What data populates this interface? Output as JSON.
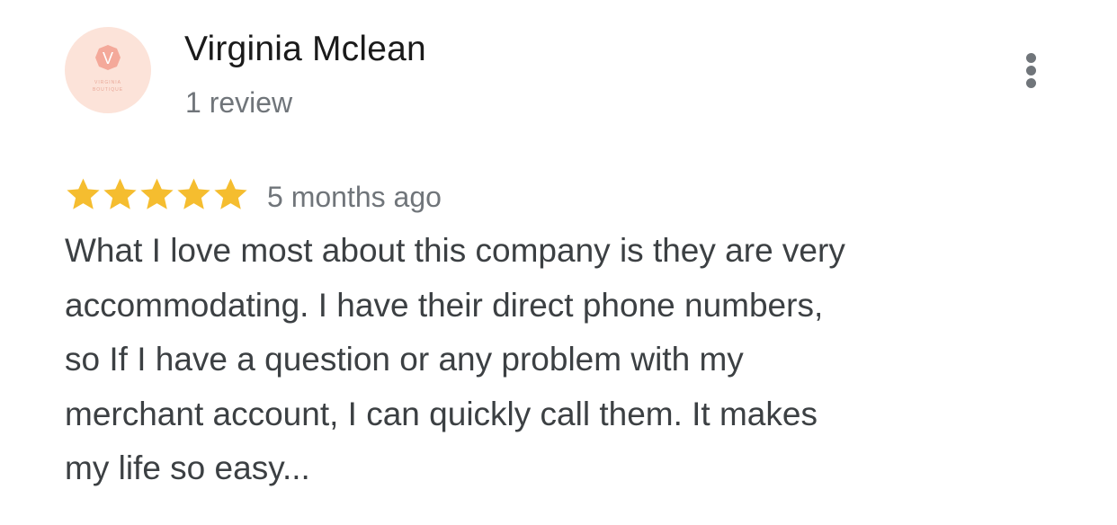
{
  "reviewer": {
    "name": "Virginia Mclean",
    "review_count": "1 review",
    "avatar": {
      "initial": "V",
      "caption_line1": "VIRGINIA",
      "caption_line2": "BOUTIQUE",
      "background": "#fce3d9",
      "badge_color": "#f4a99a"
    }
  },
  "menu": {
    "icon": "more-vert-icon"
  },
  "review": {
    "rating": 5,
    "rating_max": 5,
    "star_color": "#f5bd2f",
    "timestamp": "5 months ago",
    "text_lines": [
      "What I love most about this company is they are very",
      "accommodating. I have their direct phone numbers,",
      "so If I have a question or any problem with my",
      "merchant account, I can quickly call them. It makes",
      "my life so easy..."
    ]
  }
}
